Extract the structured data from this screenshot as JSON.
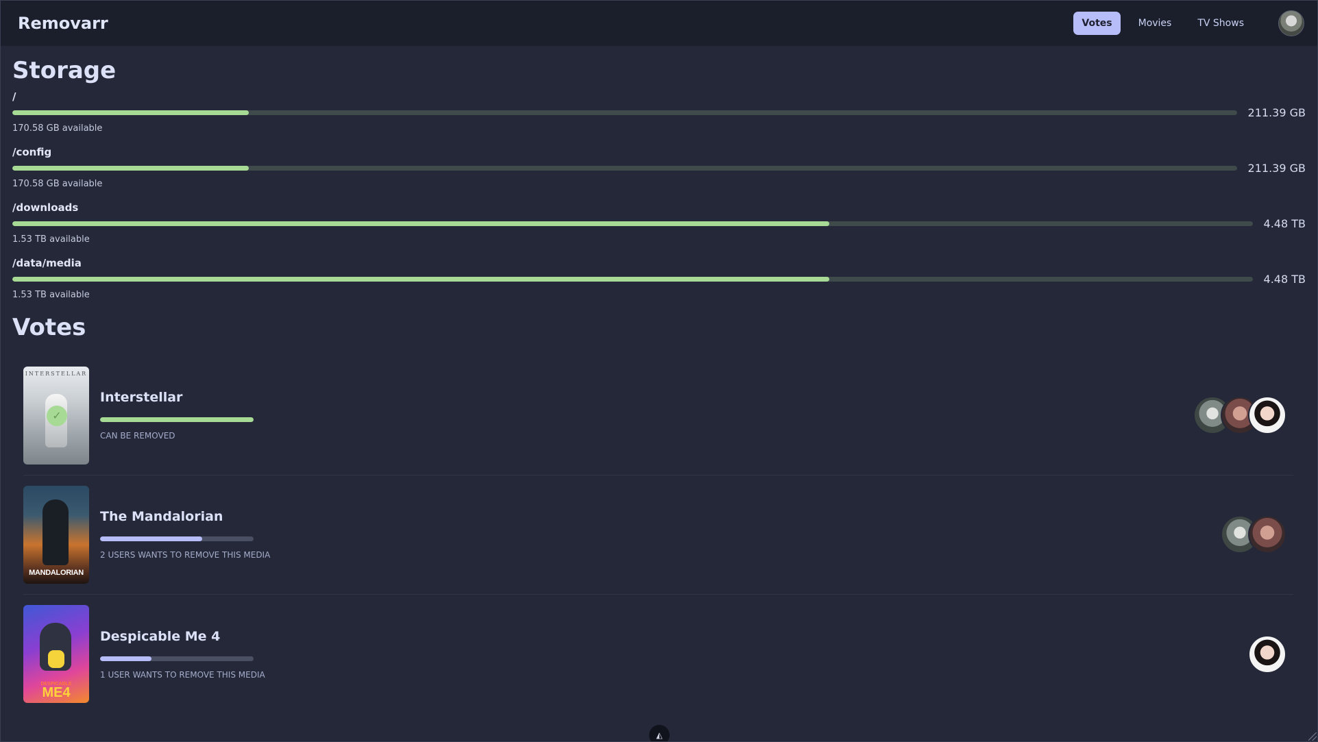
{
  "app": {
    "title": "Removarr"
  },
  "nav": {
    "items": [
      {
        "label": "Votes",
        "active": true
      },
      {
        "label": "Movies",
        "active": false
      },
      {
        "label": "TV Shows",
        "active": false
      }
    ],
    "avatar_icon": "user-avatar"
  },
  "colors": {
    "background": "#242838",
    "navbar": "#1b1e2b",
    "accent_active": "#b7bdf8",
    "storage_bar": "#a6da95",
    "vote_bar_pending": "#b7bdf8",
    "vote_bar_complete": "#a6da95"
  },
  "storage": {
    "title": "Storage",
    "disks": [
      {
        "path": "/",
        "total": "211.39 GB",
        "available": "170.58 GB available",
        "used_fraction": 0.193
      },
      {
        "path": "/config",
        "total": "211.39 GB",
        "available": "170.58 GB available",
        "used_fraction": 0.193
      },
      {
        "path": "/downloads",
        "total": "4.48 TB",
        "available": "1.53 TB available",
        "used_fraction": 0.659
      },
      {
        "path": "/data/media",
        "total": "4.48 TB",
        "available": "1.53 TB available",
        "used_fraction": 0.659
      }
    ]
  },
  "votes": {
    "title": "Votes",
    "items": [
      {
        "title": "Interstellar",
        "poster_text": "INTERSTELLAR",
        "status": "CAN BE REMOVED",
        "progress": 1.0,
        "complete": true,
        "voters": [
          "voter-a",
          "voter-b",
          "voter-c"
        ]
      },
      {
        "title": "The Mandalorian",
        "poster_text": "MANDALORIAN",
        "status": "2 USERS WANTS TO REMOVE THIS MEDIA",
        "progress": 0.667,
        "complete": false,
        "voters": [
          "voter-a",
          "voter-b"
        ]
      },
      {
        "title": "Despicable Me 4",
        "poster_text": "ME4",
        "poster_subtext": "DESPICABLE",
        "status": "1 USER WANTS TO REMOVE THIS MEDIA",
        "progress": 0.333,
        "complete": false,
        "voters": [
          "voter-c"
        ]
      }
    ]
  }
}
